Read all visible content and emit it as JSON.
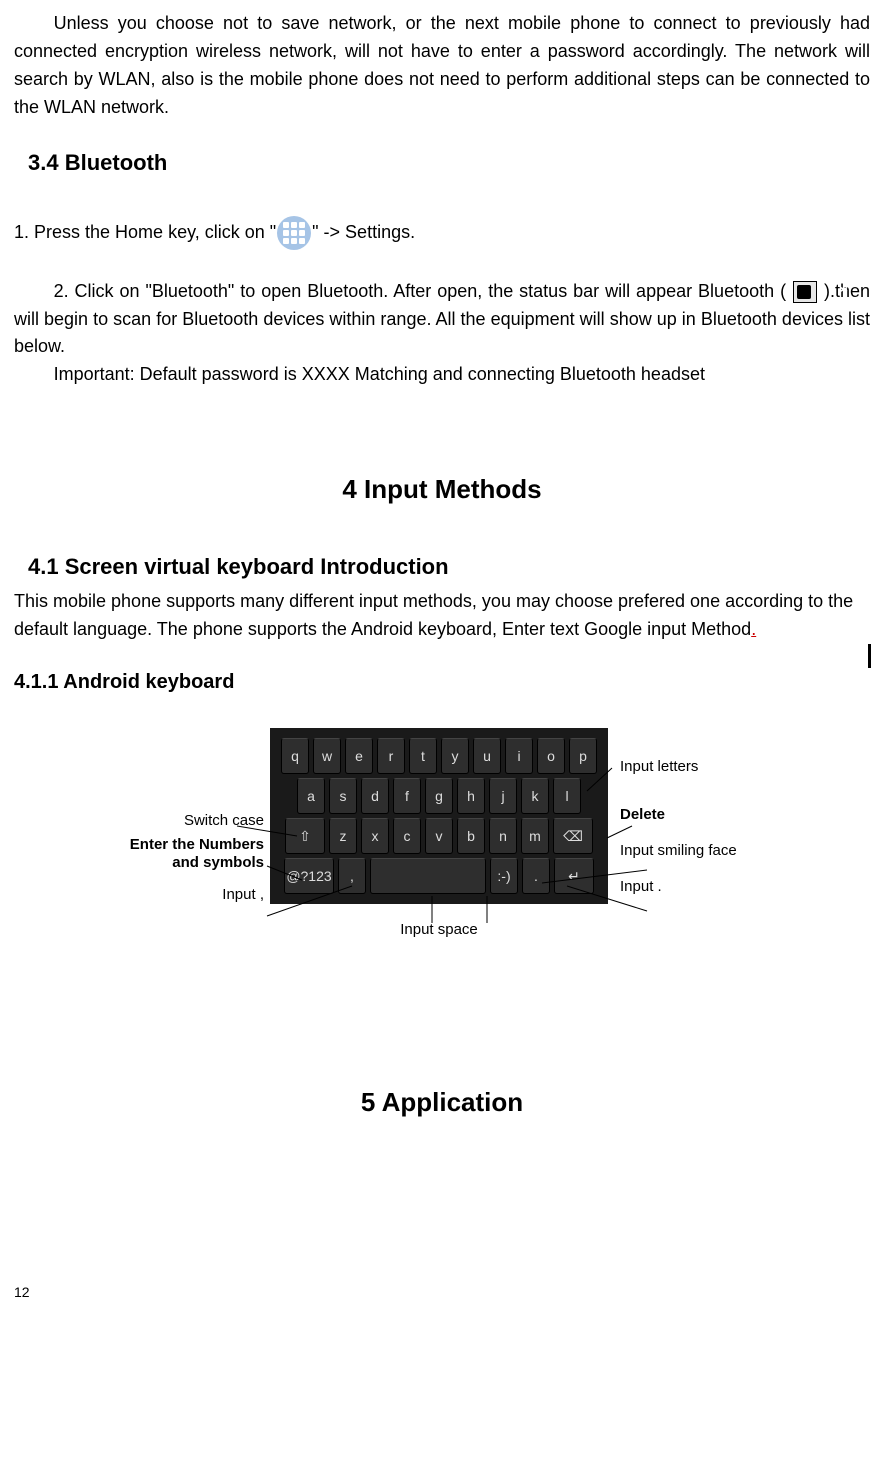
{
  "para_intro": "Unless you choose not to save network, or the next mobile phone to connect to previously had connected encryption wireless network, will not have to enter a password accordingly. The network will search by WLAN, also is the mobile phone does not need to perform additional steps can be connected to the WLAN network.",
  "sec_3_4": "3.4    Bluetooth",
  "bt_step1_pre": "1. Press the Home key, click on \"",
  "bt_step1_post": "\" -> Settings.",
  "bt_step2_pre": "2. Click on \"Bluetooth\" to open Bluetooth. After open, the status bar will appear Bluetooth ( ",
  "bt_step2_post": " ).then will begin to scan for Bluetooth devices within range. All the equipment will show up in Bluetooth devices list below.",
  "bt_important": "Important:    Default password is XXXX Matching and connecting Bluetooth headset",
  "chap4": "4    Input Methods",
  "sec_4_1": "4.1    Screen virtual keyboard Introduction",
  "para_4_1_main": "This mobile phone supports many different input methods, you may choose prefered one according to the default language. The phone supports the Android keyboard, Enter text Google input Method",
  "para_4_1_tail": ".",
  "sec_4_1_1": "4.1.1    Android keyboard",
  "kb": {
    "row1": [
      "q",
      "w",
      "e",
      "r",
      "t",
      "y",
      "u",
      "i",
      "o",
      "p"
    ],
    "row2": [
      "a",
      "s",
      "d",
      "f",
      "g",
      "h",
      "j",
      "k",
      "l"
    ],
    "row3_shift": "⇧",
    "row3_keys": [
      "z",
      "x",
      "c",
      "v",
      "b",
      "n",
      "m"
    ],
    "row3_del": "⌫",
    "row4_sym": "@?123",
    "row4_comma": ",",
    "row4_space": "",
    "row4_smile": ":-)",
    "row4_dot": ".",
    "row4_enter": "↵"
  },
  "labels": {
    "switch_case": "Switch case",
    "enter_nums": "Enter the Numbers and symbols",
    "input_comma": "Input ,",
    "input_letters": "Input letters",
    "delete": "Delete",
    "input_smile": "Input smiling face",
    "input_dot": "Input .",
    "input_space": "Input space"
  },
  "chap5": "5          Application",
  "page_num": "12"
}
